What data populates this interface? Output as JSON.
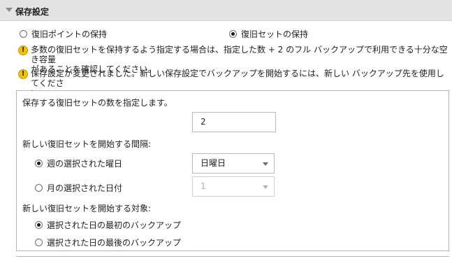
{
  "section": {
    "title": "保存設定"
  },
  "retention": {
    "option_points": "復旧ポイントの保持",
    "option_sets": "復旧セットの保持",
    "selected": "sets"
  },
  "warnings": [
    {
      "line1": "多数の復旧セットを保持するよう指定する場合は、指定した数 + 2 のフル バックアップで利用できる十分な空き容量",
      "line2": "があることを確認してください。"
    },
    {
      "line1": "保存設定が変更されました。新しい保存設定でバックアップを開始するには、新しい バックアップ先を使用してくださ",
      "line2": "い。"
    }
  ],
  "panel": {
    "count_label": "保存する復旧セットの数を指定します。",
    "count_value": "2",
    "interval_label": "新しい復旧セットを開始する間隔:",
    "weekday_option": "週の選択された曜日",
    "weekday_value": "日曜日",
    "monthday_option": "月の選択された日付",
    "monthday_value": "1",
    "interval_selected": "weekday",
    "target_label": "新しい復旧セットを開始する対象:",
    "first_backup_option": "選択された日の最初のバックアップ",
    "last_backup_option": "選択された日の最後のバックアップ",
    "target_selected": "first"
  }
}
